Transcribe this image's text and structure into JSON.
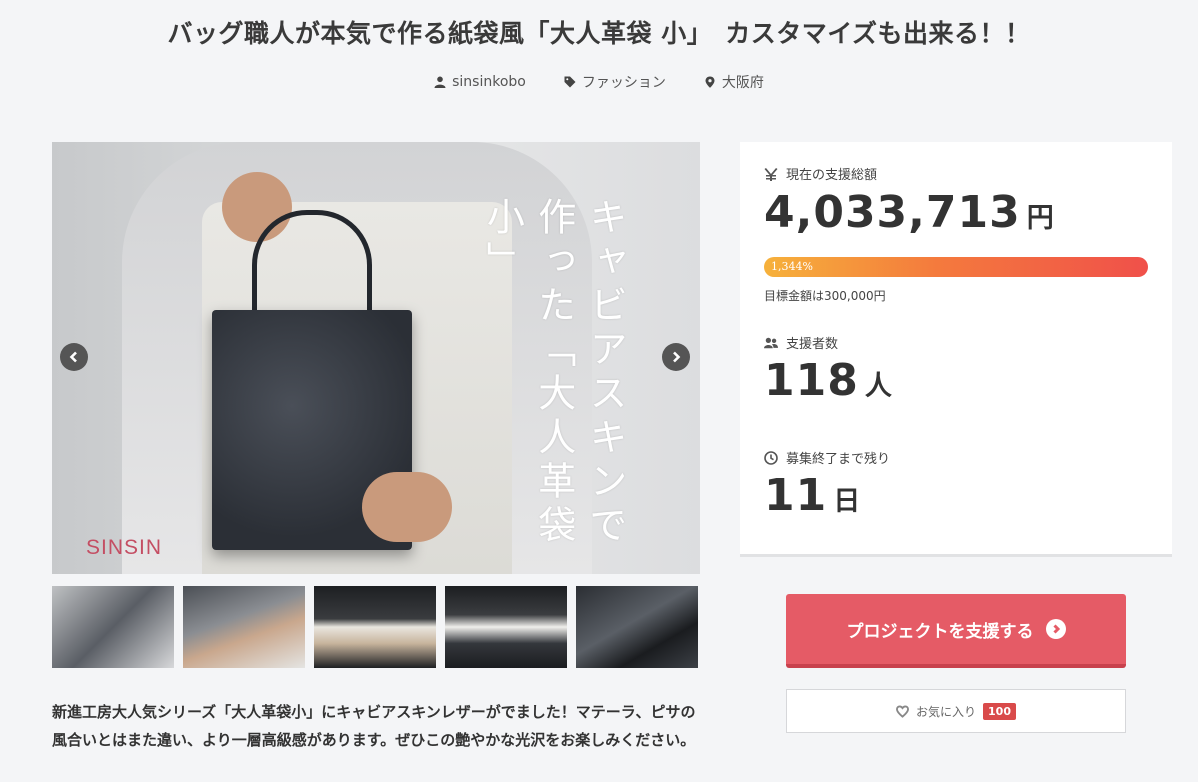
{
  "page": {
    "title": "バッグ職人が本気で作る紙袋風「大人革袋 小」　カスタマイズも出来る！！"
  },
  "meta": {
    "owner": "sinsinkobo",
    "category": "ファッション",
    "location": "大阪府"
  },
  "hero": {
    "overlay_text": "キャビアスキンで作った「大人革袋 小」",
    "brand_mark": "SINSIN"
  },
  "thumbnails": [
    "thumb-1",
    "thumb-2",
    "thumb-3",
    "thumb-4",
    "thumb-5"
  ],
  "description": "新進工房大人気シリーズ「大人革袋小」にキャビアスキンレザーがでました！マテーラ、ピサの風合いとはまた違い、より一層高級感があります。ぜひこの艶やかな光沢をお楽しみください。",
  "stats": {
    "amount_label": "現在の支援総額",
    "amount": "4,033,713",
    "amount_unit": "円",
    "progress_percent": 1344,
    "progress_label": "1,344%",
    "goal_text": "目標金額は300,000円",
    "supporters_label": "支援者数",
    "supporters": "118",
    "supporters_unit": "人",
    "remaining_label": "募集終了まで残り",
    "remaining": "11",
    "remaining_unit": "日"
  },
  "actions": {
    "support_label": "プロジェクトを支援する",
    "favorite_label": "お気に入り",
    "favorite_count": "100"
  },
  "colors": {
    "accent": "#e55b66",
    "progress_start": "#f6b13b",
    "progress_end": "#f0504a",
    "brand_mark": "#c44e63"
  },
  "icons": {
    "owner": "user-icon",
    "category": "tag-icon",
    "location": "map-pin-icon",
    "amount": "yen-icon",
    "supporters": "users-icon",
    "remaining": "clock-icon",
    "support": "chevron-right-circle-icon",
    "favorite": "heart-icon"
  }
}
